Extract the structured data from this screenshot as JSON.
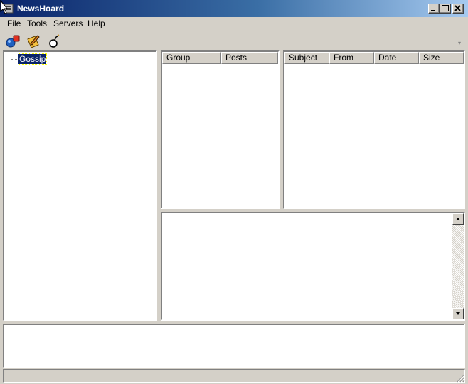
{
  "window": {
    "title": "NewsHoard"
  },
  "menu": {
    "items": [
      "File",
      "Tools",
      "Servers",
      "Help"
    ]
  },
  "toolbar": {
    "icons": [
      "connect-icon",
      "edit-icon",
      "bomb-icon"
    ]
  },
  "tree": {
    "items": [
      "Gossip"
    ]
  },
  "groups_list": {
    "columns": [
      "Group",
      "Posts"
    ]
  },
  "articles_list": {
    "columns": [
      "Subject",
      "From",
      "Date",
      "Size"
    ]
  },
  "colors": {
    "titlebar_start": "#0a246a",
    "titlebar_end": "#a6caf0",
    "face": "#d4d0c8",
    "selection": "#0a246a"
  }
}
